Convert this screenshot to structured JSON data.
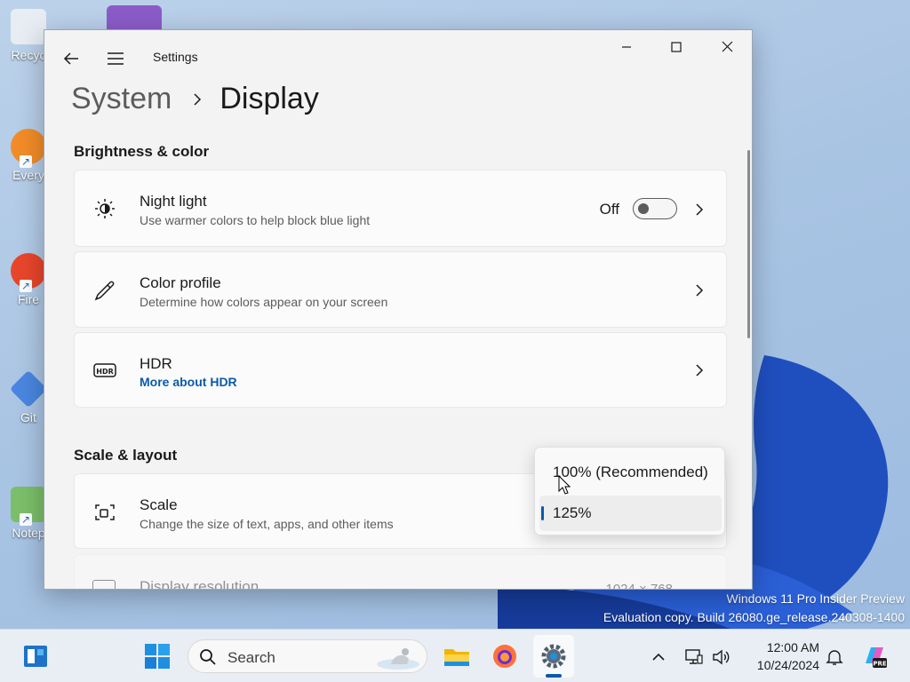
{
  "desktop": {
    "icons": [
      {
        "label": "Recyc"
      },
      {
        "label": "Every"
      },
      {
        "label": "Fire"
      },
      {
        "label": "Git"
      },
      {
        "label": "Notep"
      }
    ],
    "watermark": {
      "line1": "Windows 11 Pro Insider Preview",
      "line2": "Evaluation copy. Build 26080.ge_release.240308-1400"
    }
  },
  "window": {
    "title": "Settings",
    "breadcrumb": {
      "parent": "System",
      "current": "Display"
    },
    "sections": {
      "brightness": "Brightness & color",
      "scale": "Scale & layout"
    },
    "night_light": {
      "title": "Night light",
      "desc": "Use warmer colors to help block blue light",
      "state": "Off",
      "icon": "brightness-icon"
    },
    "color_profile": {
      "title": "Color profile",
      "desc": "Determine how colors appear on your screen",
      "icon": "eyedropper-icon"
    },
    "hdr": {
      "title": "HDR",
      "link": "More about HDR",
      "icon": "hdr-icon"
    },
    "scale_card": {
      "title": "Scale",
      "desc": "Change the size of text, apps, and other items",
      "icon": "scale-icon"
    },
    "resolution_card": {
      "title": "Display resolution",
      "value": "1024 × 768"
    },
    "scale_dropdown": {
      "options": [
        "100% (Recommended)",
        "125%"
      ],
      "selected": "125%"
    }
  },
  "taskbar": {
    "search_label": "Search",
    "clock": {
      "time": "12:00 AM",
      "date": "10/24/2024"
    }
  },
  "colors": {
    "accent": "#0a5aa8",
    "window_bg": "#f3f3f3",
    "card_bg": "#fbfbfb"
  }
}
